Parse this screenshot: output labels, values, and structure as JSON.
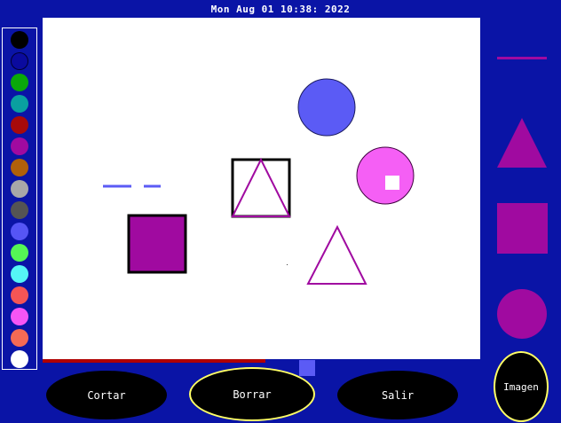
{
  "titlebar": {
    "text": "Mon Aug 01 10:38:   2022"
  },
  "palette": {
    "colors": [
      "#000000",
      "#0a0a9e",
      "#0aa80a",
      "#0aa0a0",
      "#a80a0a",
      "#a00aa0",
      "#b0600a",
      "#a8a8a8",
      "#545454",
      "#5555f5",
      "#55f555",
      "#55f5f5",
      "#f55555",
      "#f555f5",
      "#f56a55",
      "#ffffff"
    ]
  },
  "current_color": "#5b5bf5",
  "tools": {
    "color": "#a00aa0",
    "items": [
      "line-tool",
      "triangle-tool",
      "square-tool",
      "circle-tool"
    ]
  },
  "drawing": {
    "shapes": [
      "blue-circle",
      "pink-circle",
      "white-square",
      "outlined-square",
      "triangle-in-square",
      "purple-square",
      "outlined-triangle",
      "blue-dashed-line"
    ]
  },
  "buttons": {
    "cortar": "Cortar",
    "borrar": "Borrar",
    "salir": "Salir",
    "imagen": "Imagen"
  }
}
